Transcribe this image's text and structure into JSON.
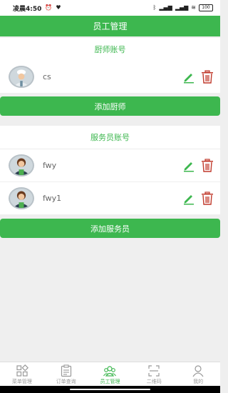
{
  "status_bar": {
    "time": "凌晨4:50",
    "battery": "100"
  },
  "header": {
    "title": "员工管理"
  },
  "chef_section": {
    "title": "厨师账号",
    "items": [
      {
        "name": "cs"
      }
    ],
    "add_label": "添加厨师"
  },
  "waiter_section": {
    "title": "服务员账号",
    "items": [
      {
        "name": "fwy"
      },
      {
        "name": "fwy1"
      }
    ],
    "add_label": "添加服务员"
  },
  "tabbar": {
    "items": [
      {
        "label": "菜单管理",
        "icon": "grid-icon"
      },
      {
        "label": "订单查询",
        "icon": "clipboard-icon"
      },
      {
        "label": "员工管理",
        "icon": "people-icon",
        "active": true
      },
      {
        "label": "二维码",
        "icon": "scan-icon"
      },
      {
        "label": "我的",
        "icon": "user-icon"
      }
    ]
  },
  "colors": {
    "accent": "#3db74f",
    "delete": "#c0392b",
    "background": "#efefef"
  }
}
